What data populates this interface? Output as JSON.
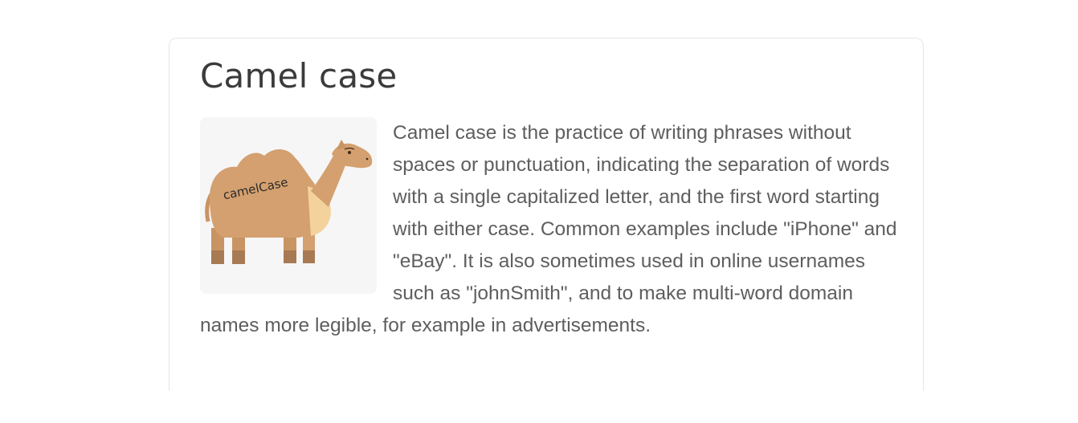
{
  "article": {
    "title": "Camel case",
    "image_text": "camelCase",
    "body": "Camel case is the practice of writing phrases without spaces or punctuation, indicating the separation of words with a single capitalized letter, and the first word starting with either case. Common examples include \"iPhone\" and \"eBay\". It is also sometimes used in online usernames such as \"johnSmith\", and to make multi-word domain names more legible, for example in advertisements."
  },
  "colors": {
    "camel_body": "#d4a06f",
    "camel_dark": "#a87a54",
    "camel_light": "#f4d29c",
    "text": "#5e5e5e",
    "title": "#3b3b3b"
  }
}
